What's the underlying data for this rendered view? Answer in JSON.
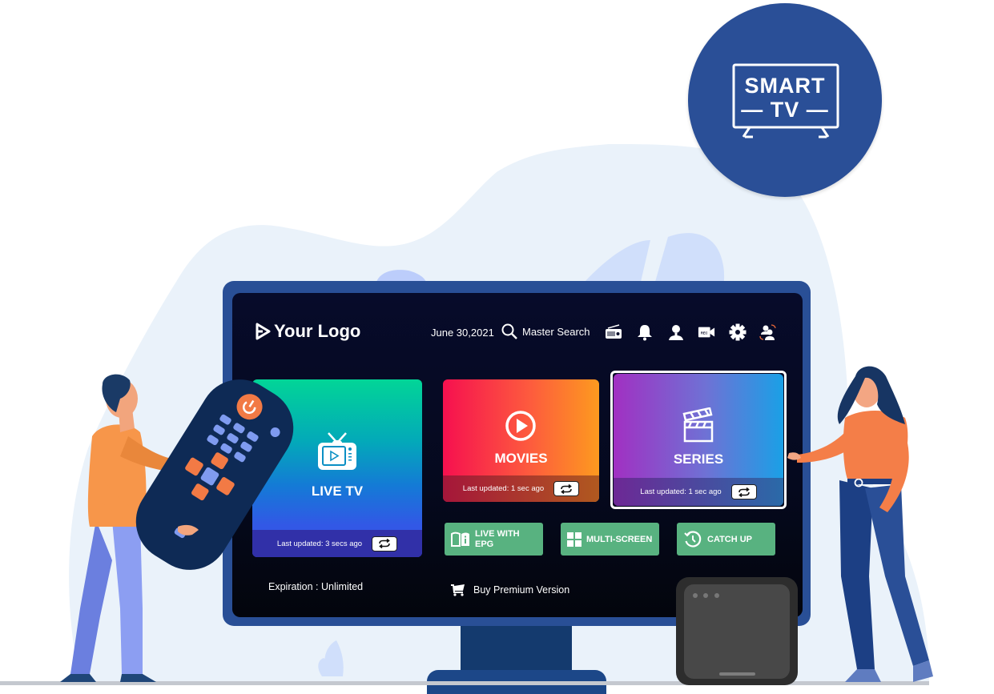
{
  "badge": {
    "line1": "SMART",
    "line2": "— TV —",
    "color": "#2a4f97",
    "icon": "smart-tv-icon"
  },
  "header": {
    "logo_text": "Your Logo",
    "date": "June 30,2021",
    "search_label": "Master Search",
    "icons": [
      "radio-icon",
      "bell-icon",
      "user-icon",
      "rec-camera-icon",
      "gear-icon",
      "switch-user-icon"
    ]
  },
  "tiles": {
    "live_tv": {
      "label": "LIVE TV",
      "updated": "Last updated: 3 secs ago",
      "icon": "tv-icon"
    },
    "movies": {
      "label": "MOVIES",
      "updated": "Last updated: 1 sec ago",
      "icon": "play-circle-icon"
    },
    "series": {
      "label": "SERIES",
      "updated": "Last updated: 1 sec ago",
      "icon": "clapperboard-icon"
    }
  },
  "buttons": {
    "epg_line1": "LIVE WITH",
    "epg_line2": "EPG",
    "multiscreen": "MULTI-SCREEN",
    "catchup": "CATCH UP",
    "accent": "#58b280"
  },
  "footer": {
    "expiration": "Expiration : Unlimited",
    "buy": "Buy Premium Version"
  }
}
